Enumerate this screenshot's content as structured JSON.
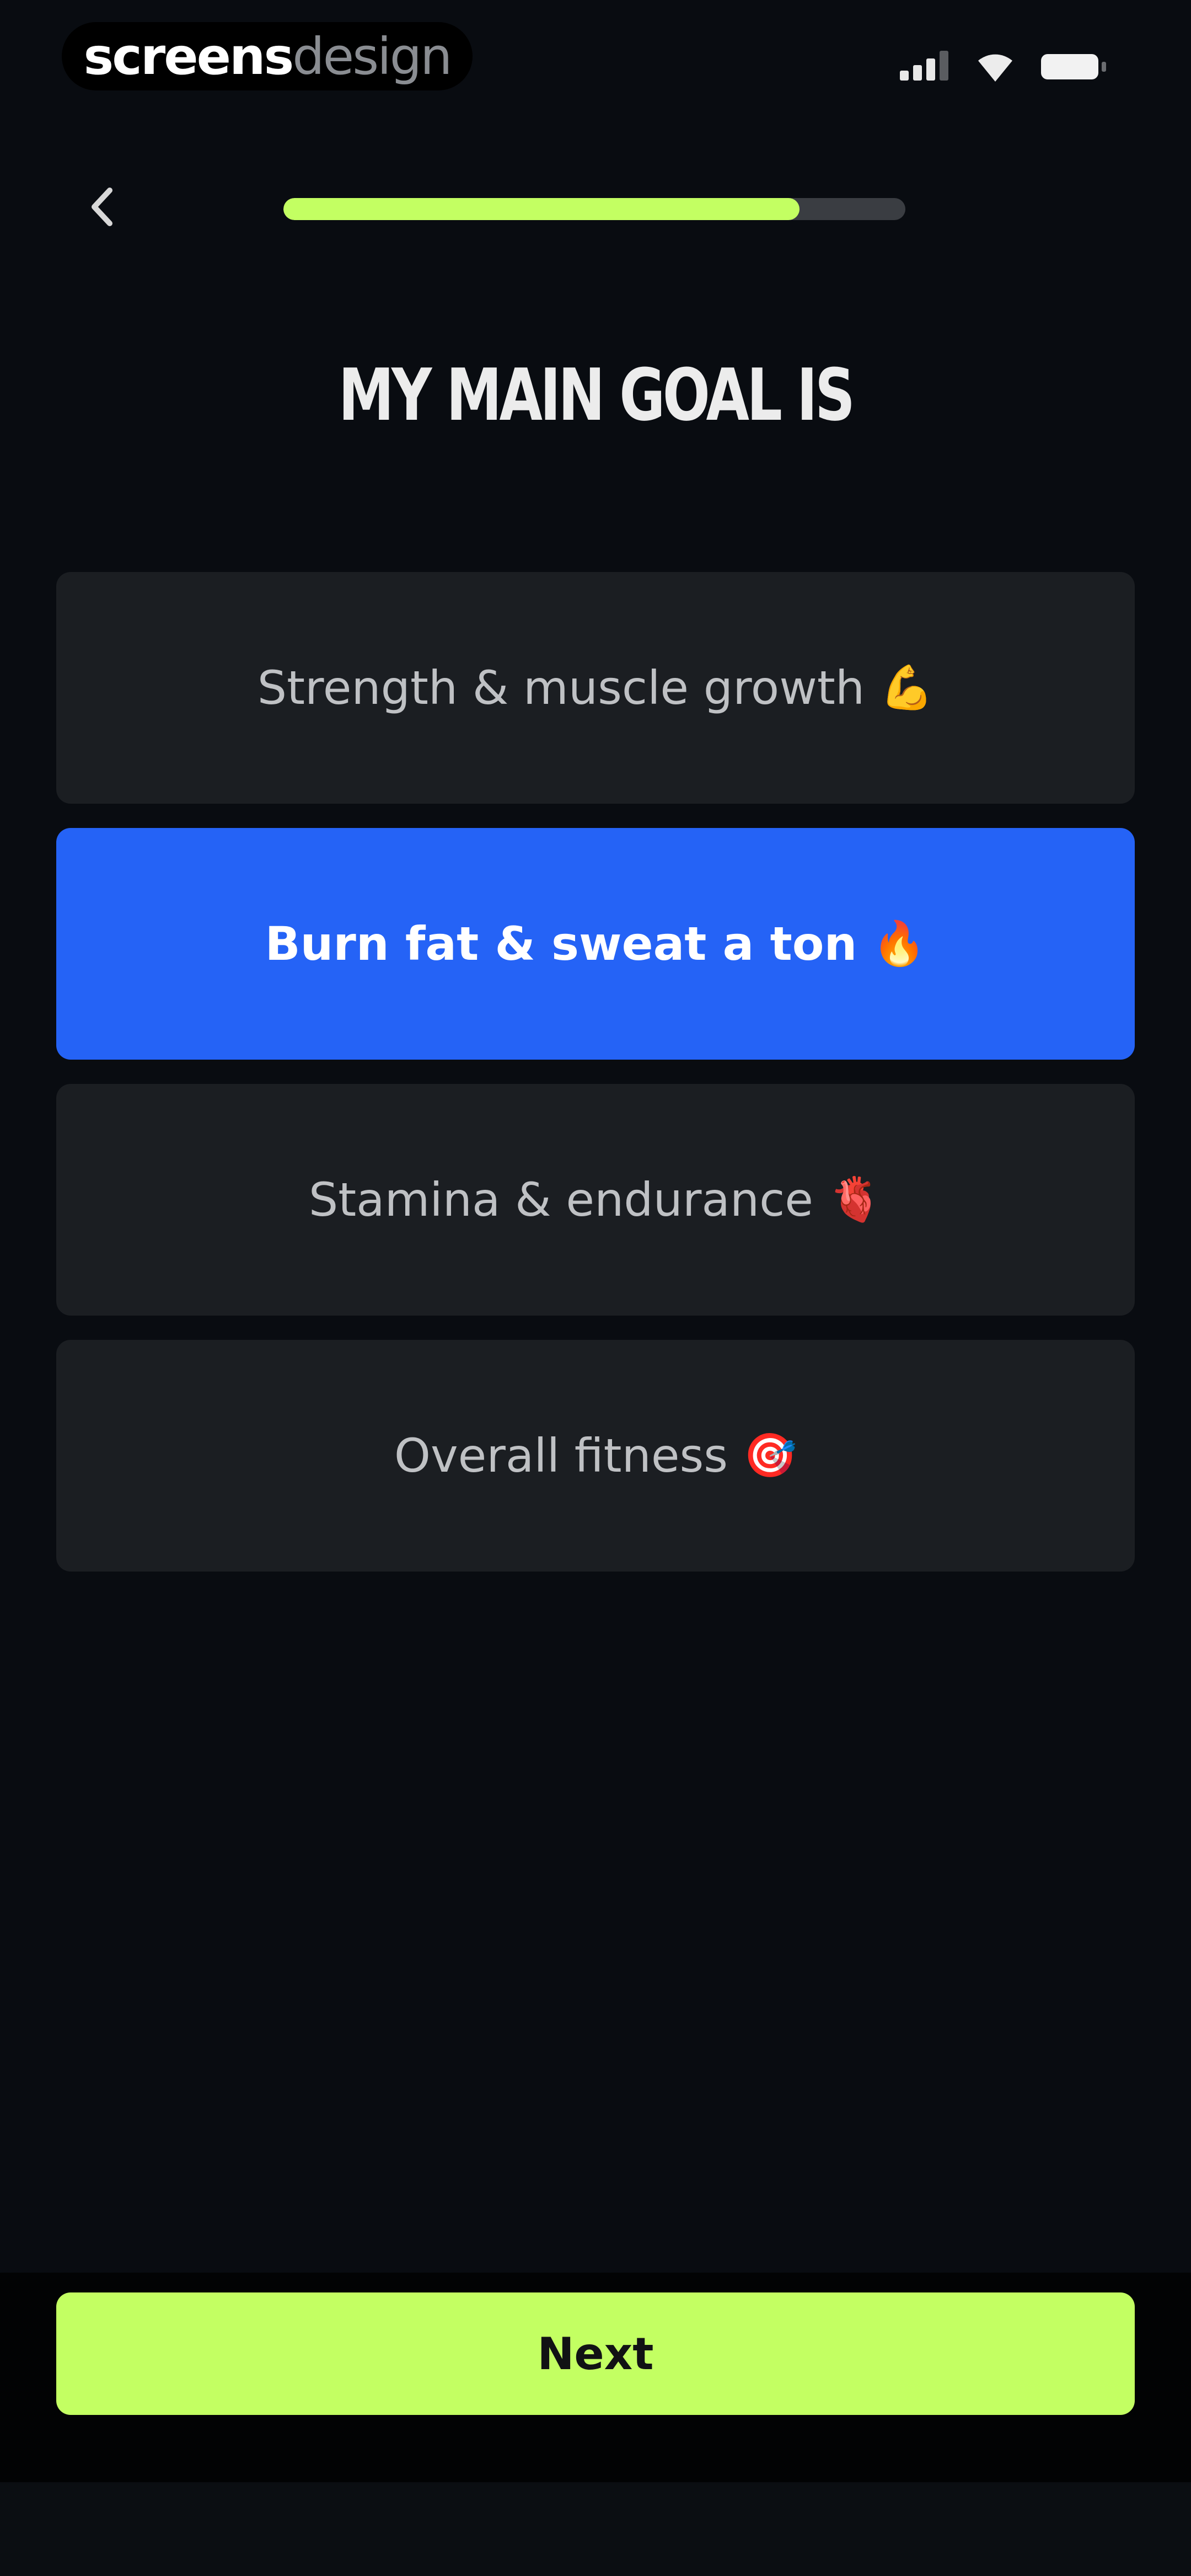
{
  "status_bar": {
    "watermark_part1": "screens",
    "watermark_part2": "design",
    "icons": [
      "signal-icon",
      "wifi-icon",
      "battery-icon"
    ]
  },
  "header": {
    "back_icon": "chevron-left-icon",
    "progress_fraction": 0.83
  },
  "title": "MY MAIN GOAL IS",
  "options": [
    {
      "label": "Strength & muscle growth",
      "emoji": "💪",
      "selected": false
    },
    {
      "label": "Burn fat & sweat a ton",
      "emoji": "🔥",
      "selected": true
    },
    {
      "label": "Stamina & endurance",
      "emoji": "🫀",
      "selected": false
    },
    {
      "label": "Overall fitness",
      "emoji": "🎯",
      "selected": false
    }
  ],
  "footer": {
    "next_label": "Next"
  },
  "colors": {
    "background": "#090c11",
    "accent_green": "#c3ff62",
    "selected_blue": "#2563f6",
    "card": "#1b1e22"
  }
}
